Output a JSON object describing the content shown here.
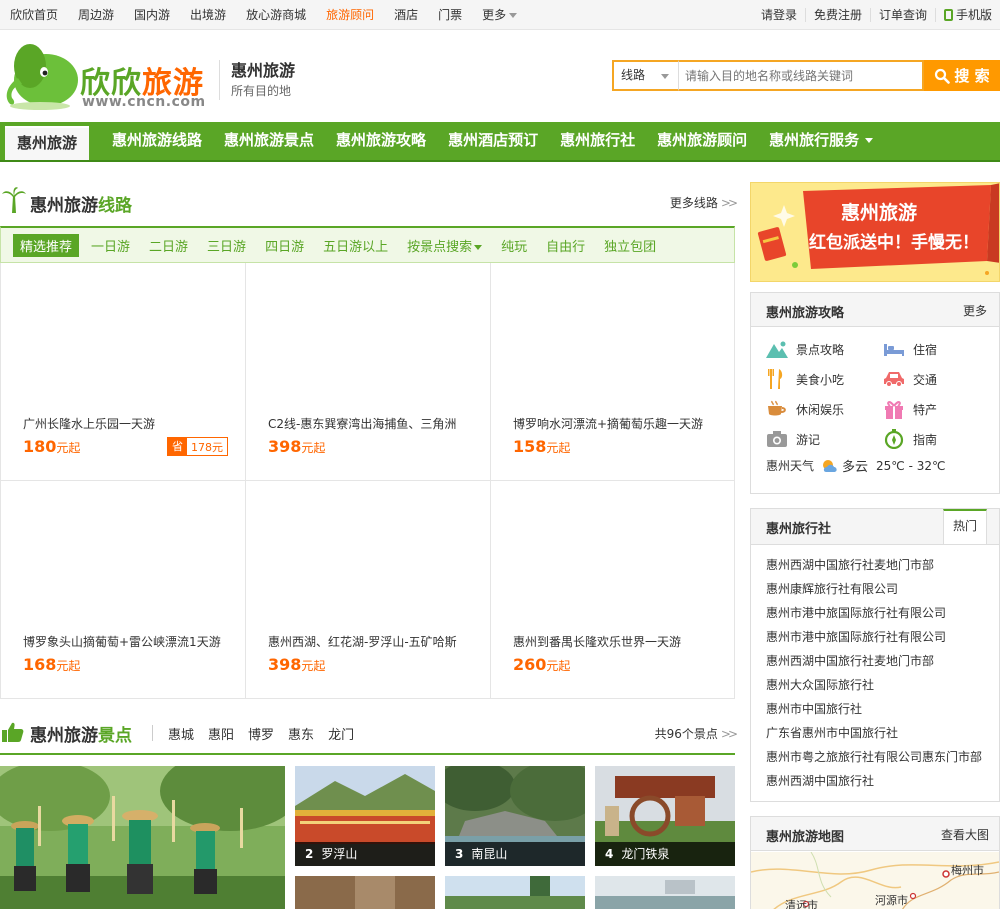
{
  "topbar": {
    "nav": [
      {
        "label": "欣欣首页",
        "active": false
      },
      {
        "label": "周边游",
        "active": false
      },
      {
        "label": "国内游",
        "active": false
      },
      {
        "label": "出境游",
        "active": false
      },
      {
        "label": "放心游商城",
        "active": false
      },
      {
        "label": "旅游顾问",
        "active": true
      },
      {
        "label": "酒店",
        "active": false
      },
      {
        "label": "门票",
        "active": false
      }
    ],
    "more": "更多",
    "right": {
      "login": "请登录",
      "register": "免费注册",
      "orders": "订单查询",
      "mobile": "手机版"
    }
  },
  "header": {
    "logo_text_a": "欣欣",
    "logo_text_b": "旅游",
    "logo_url": "www.cncn.com",
    "city": "惠州旅游",
    "city_sub": "所有目的地",
    "search": {
      "type": "线路",
      "placeholder": "请输入目的地名称或线路关键词",
      "button": "搜 索"
    }
  },
  "mainnav": [
    {
      "label": "惠州旅游",
      "active": true
    },
    {
      "label": "惠州旅游线路",
      "active": false
    },
    {
      "label": "惠州旅游景点",
      "active": false
    },
    {
      "label": "惠州旅游攻略",
      "active": false
    },
    {
      "label": "惠州酒店预订",
      "active": false
    },
    {
      "label": "惠州旅行社",
      "active": false
    },
    {
      "label": "惠州旅游顾问",
      "active": false
    },
    {
      "label": "惠州旅行服务",
      "active": false,
      "dropdown": true
    }
  ],
  "routes": {
    "title_a": "惠州旅游",
    "title_b": "线路",
    "more": "更多线路",
    "tabs": [
      {
        "label": "精选推荐",
        "active": true
      },
      {
        "label": "一日游"
      },
      {
        "label": "二日游"
      },
      {
        "label": "三日游"
      },
      {
        "label": "四日游"
      },
      {
        "label": "五日游以上"
      },
      {
        "label": "按景点搜索",
        "dropdown": true
      },
      {
        "label": "纯玩"
      },
      {
        "label": "自由行"
      },
      {
        "label": "独立包团"
      }
    ],
    "unit": "元起",
    "items": [
      {
        "name": "广州长隆水上乐园一天游",
        "price": "180",
        "save_label": "省",
        "save_value": "178元"
      },
      {
        "name": "C2线-惠东巽寮湾出海捕鱼、三角洲",
        "price": "398"
      },
      {
        "name": "博罗响水河漂流+摘葡萄乐趣一天游",
        "price": "158"
      },
      {
        "name": "博罗象头山摘葡萄+雷公峡漂流1天游",
        "price": "168"
      },
      {
        "name": "惠州西湖、红花湖-罗浮山-五矿哈斯",
        "price": "398"
      },
      {
        "name": "惠州到番禺长隆欢乐世界一天游",
        "price": "260"
      }
    ]
  },
  "sights": {
    "title_a": "惠州旅游",
    "title_b": "景点",
    "cities": [
      "惠城",
      "惠阳",
      "博罗",
      "惠东",
      "龙门"
    ],
    "count": "共96个景点",
    "items": [
      {
        "num": "2",
        "name": "罗浮山"
      },
      {
        "num": "3",
        "name": "南昆山"
      },
      {
        "num": "4",
        "name": "龙门铁泉"
      }
    ]
  },
  "banner": {
    "line1": "惠州旅游",
    "line2": "红包派送中！手慢无！"
  },
  "guide": {
    "title": "惠州旅游攻略",
    "more": "更多",
    "items": [
      {
        "label": "景点攻略",
        "icon": "mountain-icon",
        "color": "#5bbfb0"
      },
      {
        "label": "住宿",
        "icon": "bed-icon",
        "color": "#7a9bd6"
      },
      {
        "label": "美食小吃",
        "icon": "fork-knife-icon",
        "color": "#f5a623"
      },
      {
        "label": "交通",
        "icon": "car-icon",
        "color": "#f06a6a"
      },
      {
        "label": "休闲娱乐",
        "icon": "cup-icon",
        "color": "#d98c3c"
      },
      {
        "label": "特产",
        "icon": "gift-icon",
        "color": "#f07ab3"
      },
      {
        "label": "游记",
        "icon": "camera-icon",
        "color": "#999999"
      },
      {
        "label": "指南",
        "icon": "compass-icon",
        "color": "#5aa626"
      }
    ],
    "weather_label": "惠州天气",
    "weather_desc": "多云",
    "weather_temp": "25℃ - 32℃"
  },
  "agencies": {
    "title": "惠州旅行社",
    "tab": "热门",
    "list": [
      "惠州西湖中国旅行社麦地门市部",
      "惠州康辉旅行社有限公司",
      "惠州市港中旅国际旅行社有限公司",
      "惠州市港中旅国际旅行社有限公司",
      "惠州西湖中国旅行社麦地门市部",
      "惠州大众国际旅行社",
      "惠州市中国旅行社",
      "广东省惠州市中国旅行社",
      "惠州市粤之旅旅行社有限公司惠东门市部",
      "惠州西湖中国旅行社"
    ]
  },
  "map": {
    "title": "惠州旅游地图",
    "more": "查看大图",
    "labels": {
      "meizhou": "梅州市",
      "heyuan": "河源市",
      "qingyuan": "清远市"
    }
  },
  "colors": {
    "brand_green": "#5aa626",
    "brand_orange": "#ff6600",
    "search_orange": "#ff9900"
  }
}
